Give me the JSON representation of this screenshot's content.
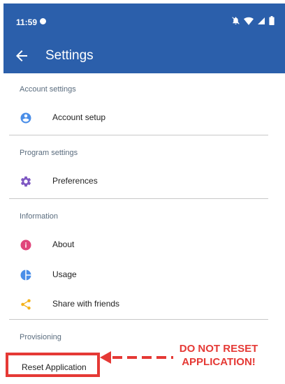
{
  "status": {
    "time": "11:59"
  },
  "appbar": {
    "title": "Settings"
  },
  "sections": {
    "account": {
      "title": "Account settings",
      "items": [
        {
          "label": "Account setup",
          "icon": "account-circle-icon",
          "color": "#4a8ee8"
        }
      ]
    },
    "program": {
      "title": "Program settings",
      "items": [
        {
          "label": "Preferences",
          "icon": "gear-icon",
          "color": "#7e57c2"
        }
      ]
    },
    "information": {
      "title": "Information",
      "items": [
        {
          "label": "About",
          "icon": "info-icon",
          "color": "#e0457b"
        },
        {
          "label": "Usage",
          "icon": "pie-chart-icon",
          "color": "#4a8ee8"
        },
        {
          "label": "Share with friends",
          "icon": "share-icon",
          "color": "#f5b21a"
        }
      ]
    },
    "provisioning": {
      "title": "Provisioning",
      "items": [
        {
          "label": "Reset Application"
        }
      ]
    }
  },
  "annotation": {
    "line1": "DO NOT RESET",
    "line2": "APPLICATION!",
    "color": "#e53935"
  },
  "colors": {
    "brand": "#2b5fab"
  }
}
